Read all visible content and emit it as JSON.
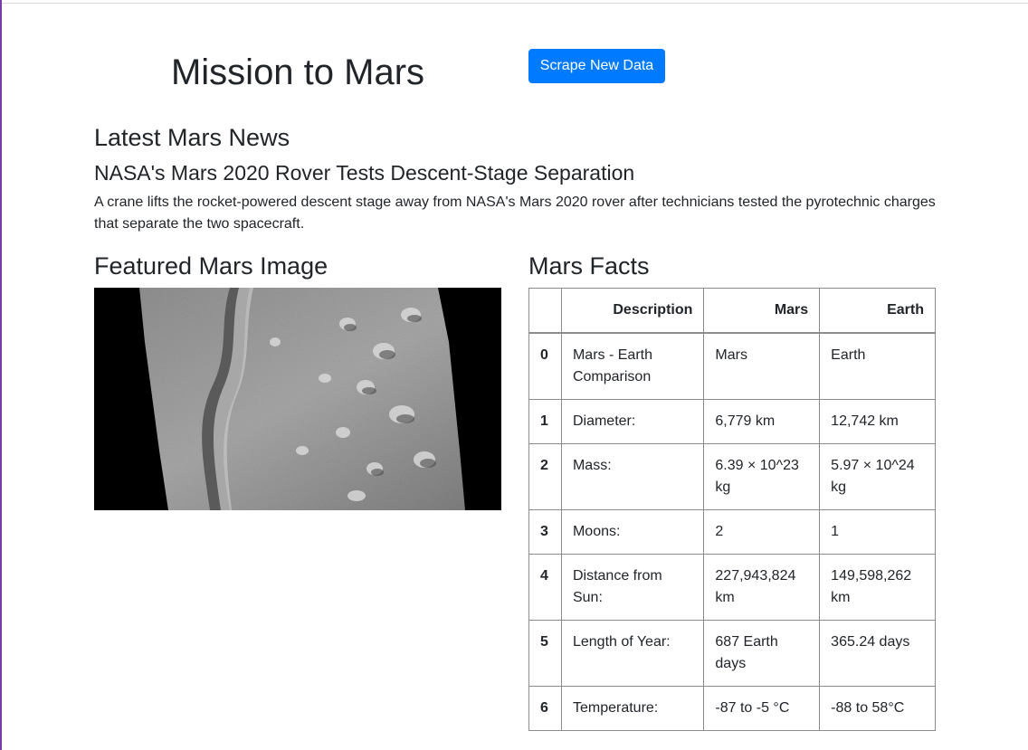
{
  "header": {
    "title": "Mission to Mars",
    "scrape_button_label": "Scrape New Data"
  },
  "news": {
    "heading": "Latest Mars News",
    "title": "NASA's Mars 2020 Rover Tests Descent-Stage Separation",
    "teaser": "A crane lifts the rocket-powered descent stage away from NASA's Mars 2020 rover after technicians tested the pyrotechnic charges that separate the two spacecraft."
  },
  "featured_image": {
    "heading": "Featured Mars Image"
  },
  "facts": {
    "heading": "Mars Facts",
    "columns": [
      "",
      "Description",
      "Mars",
      "Earth"
    ],
    "rows": [
      {
        "index": "0",
        "description": "Mars - Earth Comparison",
        "mars": "Mars",
        "earth": "Earth"
      },
      {
        "index": "1",
        "description": "Diameter:",
        "mars": "6,779 km",
        "earth": "12,742 km"
      },
      {
        "index": "2",
        "description": "Mass:",
        "mars": "6.39 × 10^23 kg",
        "earth": "5.97 × 10^24 kg"
      },
      {
        "index": "3",
        "description": "Moons:",
        "mars": "2",
        "earth": "1"
      },
      {
        "index": "4",
        "description": "Distance from Sun:",
        "mars": "227,943,824 km",
        "earth": "149,598,262 km"
      },
      {
        "index": "5",
        "description": "Length of Year:",
        "mars": "687 Earth days",
        "earth": "365.24 days"
      },
      {
        "index": "6",
        "description": "Temperature:",
        "mars": "-87 to -5 °C",
        "earth": "-88 to 58°C"
      }
    ]
  },
  "colors": {
    "accent": "#007bff",
    "text": "#212529",
    "table_border": "#8c8c8c"
  }
}
